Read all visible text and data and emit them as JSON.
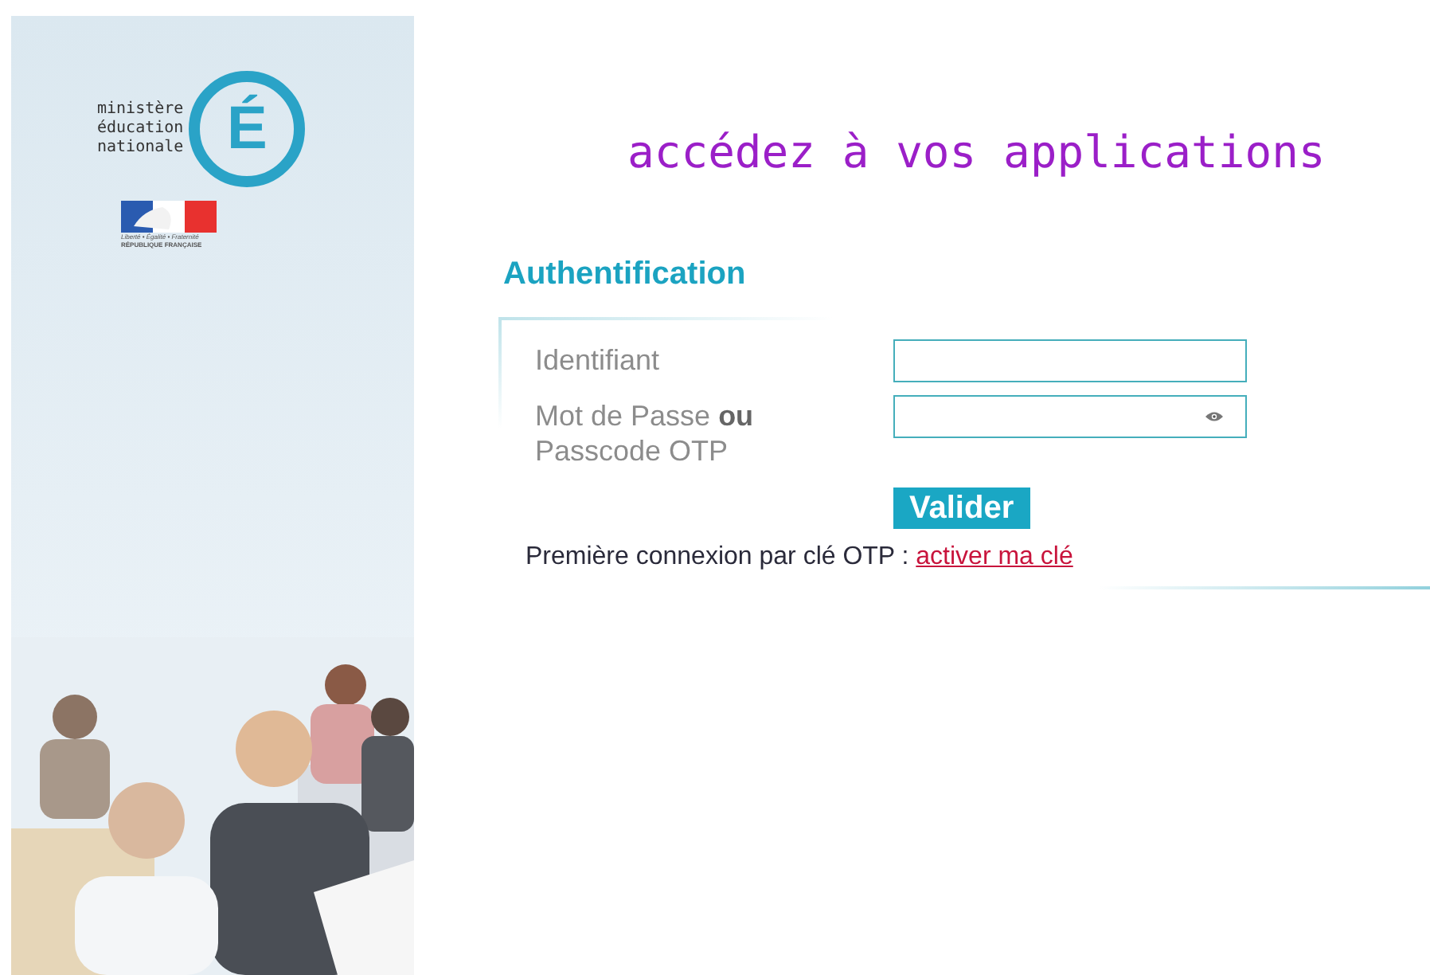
{
  "logo": {
    "lines": [
      "ministère",
      "éducation",
      "nationale"
    ],
    "letter": "É",
    "flag_motto": "Liberté • Égalité • Fraternité",
    "flag_name": "RÉPUBLIQUE FRANÇAISE"
  },
  "heading": "accédez à vos applications",
  "auth": {
    "title": "Authentification",
    "fields": [
      {
        "label": "Identifiant",
        "kind": "text"
      },
      {
        "label": "Mot de Passe **ou** Passcode OTP",
        "kind": "password"
      }
    ],
    "submit": "Valider",
    "note": "Première connexion par clé OTP : ",
    "link": "activer ma clé"
  }
}
